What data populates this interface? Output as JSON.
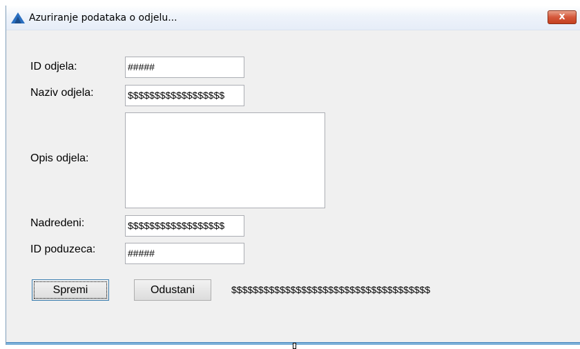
{
  "window": {
    "title": "Azuriranje podataka o odjelu...",
    "close_glyph": "x",
    "icon": "app-triangle-icon"
  },
  "form": {
    "id_label": "ID odjela:",
    "id_value": "#####",
    "name_label": "Naziv odjela:",
    "name_value": "$$$$$$$$$$$$$$$$$$",
    "desc_label": "Opis odjela:",
    "desc_value": "",
    "manager_label": "Nadredeni:",
    "manager_value": "$$$$$$$$$$$$$$$$$$",
    "company_label": "ID poduzeca:",
    "company_value": "#####"
  },
  "buttons": {
    "save": "Spremi",
    "cancel": "Odustani"
  },
  "status_text": "$$$$$$$$$$$$$$$$$$$$$$$$$$$$$$$$$$$$$",
  "colors": {
    "window_bg": "#f0f0f0",
    "close_button": "#c3401f",
    "icon_blue": "#2a6fc0"
  }
}
